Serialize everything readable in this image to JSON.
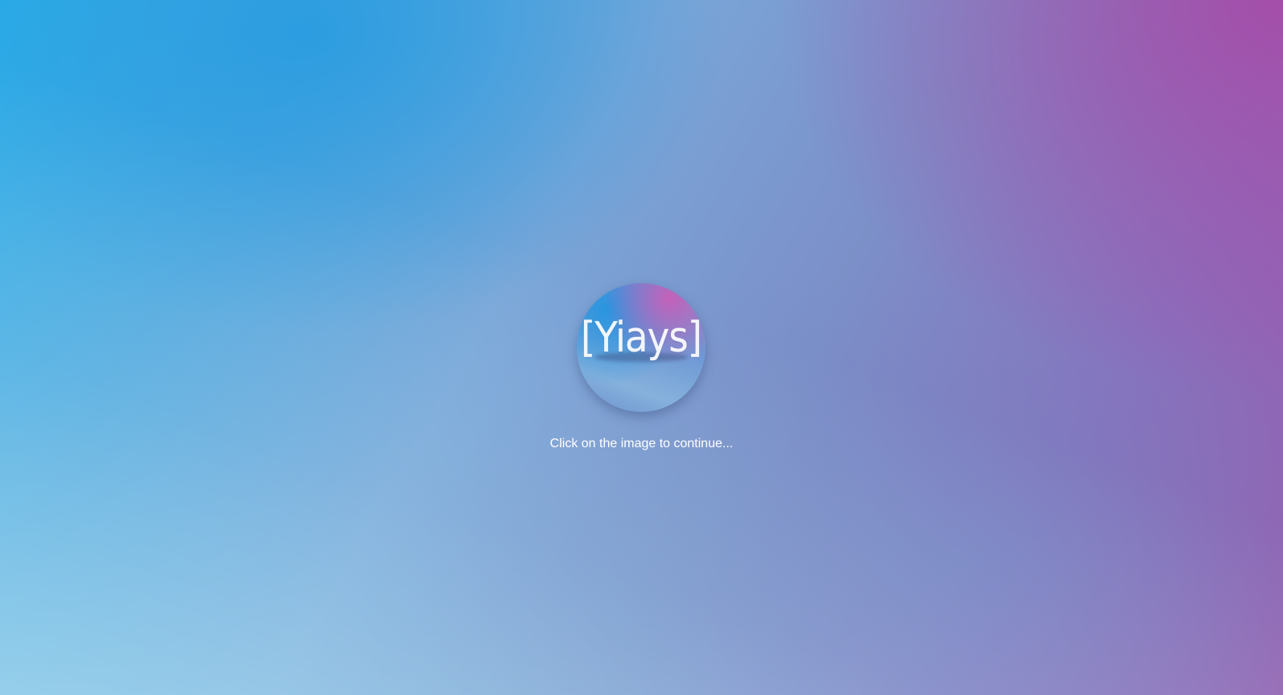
{
  "logo": {
    "text": "[Yiays]"
  },
  "hint": {
    "text": "Click on the image to continue..."
  },
  "colors": {
    "top_left": "#2aaee8",
    "top_right": "#a64ca8",
    "bottom_left": "#a0d8ec",
    "text": "#ffffff"
  }
}
